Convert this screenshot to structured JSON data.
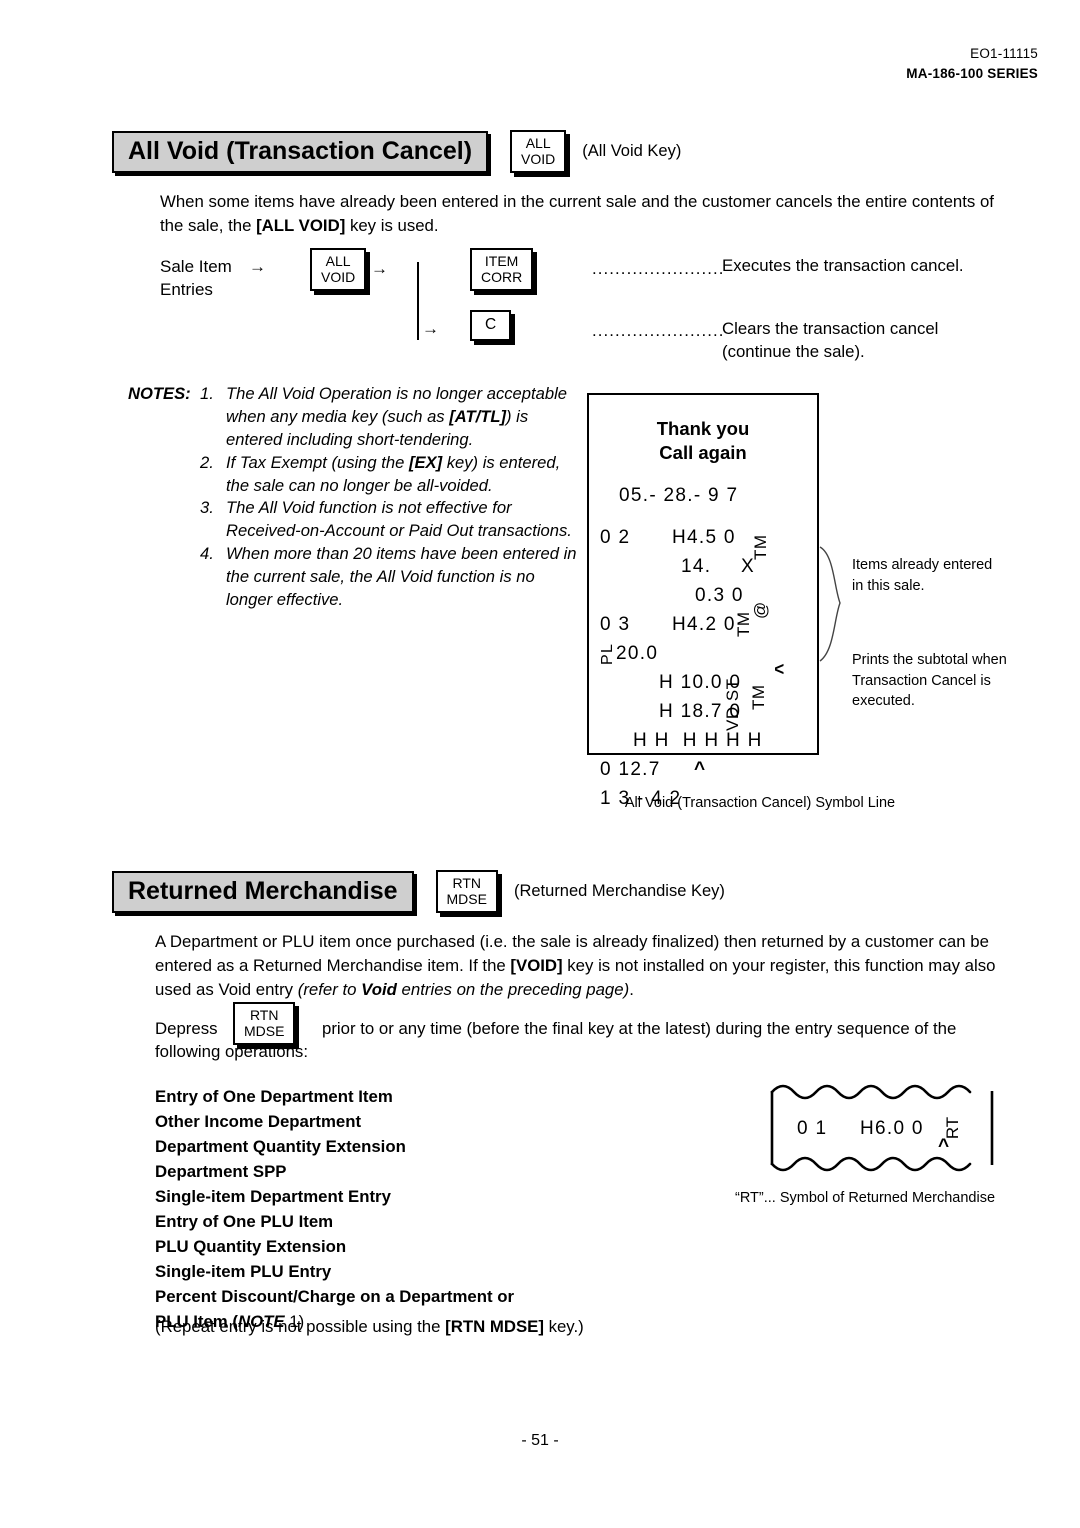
{
  "header": {
    "doc_code": "EO1-11115",
    "series": "MA-186-100 SERIES"
  },
  "section_all_void": {
    "title": "All Void (Transaction Cancel)",
    "key_line1": "ALL",
    "key_line2": "VOID",
    "key_caption": "(All Void Key)",
    "intro": "When some items have already been entered in the current sale and the customer cancels the entire contents of the sale, the [ALL VOID] key is used.",
    "intro_bold": "[ALL VOID]",
    "flow": {
      "source_line1": "Sale Item",
      "source_line2": "Entries",
      "arrow1": "→",
      "arrow2": "→",
      "arrow3": "→",
      "key_allvoid_l1": "ALL",
      "key_allvoid_l2": "VOID",
      "key_itemcorr_l1": "ITEM",
      "key_itemcorr_l2": "CORR",
      "key_clear": "C",
      "leader": ".......................",
      "result1": "Executes the transaction cancel.",
      "result2_line1": "Clears the transaction cancel",
      "result2_line2": "(continue the sale)."
    },
    "notes_label": "NOTES:",
    "notes": [
      {
        "num": "1.",
        "text_a": "The All Void Operation is no longer acceptable when any media key (such as ",
        "bold": "[AT/TL]",
        "text_b": ") is entered including short-tendering."
      },
      {
        "num": "2.",
        "text_a": "If Tax Exempt (using the ",
        "bold": "[EX]",
        "text_b": " key) is entered, the sale can no longer be all-voided."
      },
      {
        "num": "3.",
        "text_a": "The All Void function is not effective for Received-on-Account or Paid Out transactions.",
        "bold": "",
        "text_b": ""
      },
      {
        "num": "4.",
        "text_a": "When more than 20 items have been entered in the current sale, the All Void function is no longer effective.",
        "bold": "",
        "text_b": ""
      }
    ],
    "receipt": {
      "head1": "Thank you",
      "head2": "Call again",
      "date": "05.- 28.- 9 7",
      "rows": [
        {
          "left": "0 2",
          "mid": "H4.5 0",
          "right": ""
        },
        {
          "left": "",
          "mid": "14.",
          "right": "X"
        },
        {
          "left": "",
          "mid": "0.3 0",
          "right": ""
        },
        {
          "left": "0 3",
          "mid": "H4.2 0",
          "right": ""
        },
        {
          "left": "PL",
          "mid": "20.0",
          "right": ""
        },
        {
          "left": "",
          "mid": "H 10.0 0",
          "right": ""
        },
        {
          "left": "",
          "mid": "H 18.7 0",
          "right": ""
        },
        {
          "left": "",
          "mid": "H H  H H H H",
          "right": ""
        },
        {
          "left": "0 12.7",
          "mid": "^",
          "right": ""
        },
        {
          "left": "1 3 - 4 2",
          "mid": "",
          "right": ""
        }
      ],
      "symbols": [
        "TM",
        "@",
        "TM",
        "TM",
        "VD ST"
      ],
      "caret": "^",
      "caret2": "^"
    },
    "callout_items": "Items already entered in this sale.",
    "callout_subtotal": "Prints the subtotal when Transaction Cancel is executed.",
    "caption": "All Void (Transaction Cancel) Symbol Line"
  },
  "section_returned": {
    "title": "Returned Merchandise",
    "key_line1": "RTN",
    "key_line2": "MDSE",
    "key_caption": "(Returned Merchandise Key)",
    "para_a": "A Department or PLU item once purchased (i.e. the sale is already finalized) then returned by a customer can be entered as a Returned Merchandise item. If the ",
    "para_bold": "[VOID]",
    "para_b": " key is not installed on your register, this function may also used as Void entry ",
    "para_ital_a": "(refer to ",
    "para_ital_bold": "Void",
    "para_ital_b": " entries on the preceding page)",
    "para_end": ".",
    "depress_label": "Depress",
    "depress_key_l1": "RTN",
    "depress_key_l2": "MDSE",
    "depress_text_line1": "prior to or any time (before the final key at the latest) during the entry sequence of the",
    "depress_text_line2": "following operations:",
    "ops": [
      "Entry of One Department Item",
      "Other Income Department",
      "Department Quantity Extension",
      "Department SPP",
      "Single-item Department Entry",
      "Entry of One PLU Item",
      "PLU Quantity Extension",
      "Single-item PLU Entry",
      "Percent Discount/Charge on a Department or"
    ],
    "ops_last_a": "PLU Item (",
    "ops_last_ital": "NOTE",
    "ops_last_b": " 1)",
    "receipt": {
      "left": "0 1",
      "mid": "H6.0 0",
      "symbol": "RT",
      "caret": "^"
    },
    "receipt_caption": "“RT”... Symbol of Returned Merchandise",
    "closing_a": "(Repeat entry is not possible using the ",
    "closing_bold": "[RTN MDSE]",
    "closing_b": " key.)"
  },
  "footer": {
    "page": "- 51 -"
  }
}
